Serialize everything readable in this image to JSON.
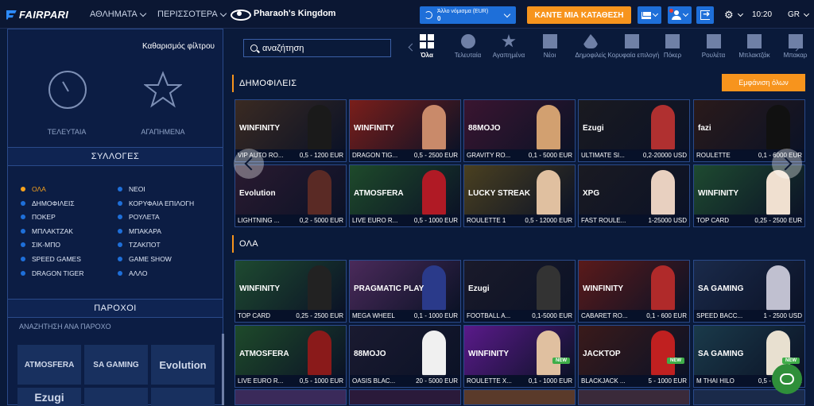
{
  "header": {
    "logo": "FAIRPARI",
    "nav": [
      {
        "label": "ΑΘΛΗΜΑΤΑ"
      },
      {
        "label": "ΠΕΡΙΣΣΟΤΕΡΑ"
      }
    ],
    "game_title": "Pharaoh's Kingdom",
    "currency_label": "Άλλο νόμισμα (EUR)",
    "currency_value": "0",
    "deposit_label": "ΚΑΝΤΕ ΜΙΑ ΚΑΤΑΘΕΣΗ",
    "time": "10:20",
    "lang": "GR"
  },
  "sidebar": {
    "clear_filter": "Καθαρισμός φίλτρου",
    "recent_label": "ΤΕΛΕΥΤΑΙΑ",
    "favorites_label": "ΑΓΑΠΗΜΕΝΑ",
    "collections_title": "ΣΥΛΛΟΓΕΣ",
    "collections_left": [
      "ΟΛΑ",
      "ΔΗΜΟΦΙΛΕΙΣ",
      "ΠΟΚΕΡ",
      "ΜΠΛΑΚΤΖΑΚ",
      "ΣΙΚ-ΜΠΟ",
      "SPEED GAMES",
      "DRAGON TIGER"
    ],
    "collections_right": [
      "ΝΕΟΙ",
      "ΚΟΡΥΦΑΙΑ ΕΠΙΛΟΓΗ",
      "ΡΟΥΛΕΤΑ",
      "ΜΠΑΚΑΡΑ",
      "ΤΖΑΚΠΟΤ",
      "GAME SHOW",
      "ΑΛΛΟ"
    ],
    "providers_title": "ΠΑΡΟΧΟΙ",
    "providers_search": "ΑΝΑΖΗΤΗΣΗ ΑΝΑ ΠΑΡΟΧΟ",
    "providers": [
      "ATMOSFERA",
      "SA GAMING",
      "Evolution",
      "Ezugi"
    ]
  },
  "search": {
    "value": "αναζήτηση"
  },
  "categories": [
    {
      "label": "Όλα",
      "icon": "grid-icon"
    },
    {
      "label": "Τελευταία",
      "icon": "clock-icon"
    },
    {
      "label": "Αγαπημένα",
      "icon": "star-icon"
    },
    {
      "label": "Νέοι",
      "icon": "new-icon"
    },
    {
      "label": "Δημοφιλείς",
      "icon": "flame-icon"
    },
    {
      "label": "Κορυφαία επιλογή",
      "icon": "top-pick-icon"
    },
    {
      "label": "Πόκερ",
      "icon": "poker-icon"
    },
    {
      "label": "Ρουλέτα",
      "icon": "roulette-icon"
    },
    {
      "label": "Μπλακτζάκ",
      "icon": "blackjack-icon"
    },
    {
      "label": "Μπακαρ",
      "icon": "baccarat-icon"
    }
  ],
  "popular": {
    "title": "ΔΗΜΟΦΙΛΕΙΣ",
    "show_all": "Εμφάνιση όλων",
    "games": [
      {
        "name": "VIP AUTO RO...",
        "limits": "0,5 - 1200 EUR",
        "brand": "WINFINITY",
        "bg": "#3a2a22",
        "fig": "#1a1a1a"
      },
      {
        "name": "DRAGON TIG...",
        "limits": "0,5 - 2500 EUR",
        "brand": "WINFINITY",
        "bg": "#7a1e1a",
        "fig": "#c98a6a"
      },
      {
        "name": "GRAVITY RO...",
        "limits": "0,1 - 5000 EUR",
        "brand": "88MOJO",
        "bg": "#3a1530",
        "fig": "#d2a070"
      },
      {
        "name": "ULTIMATE SI...",
        "limits": "0,2-20000 USD",
        "brand": "Ezugi",
        "bg": "#1a1a20",
        "fig": "#b03030"
      },
      {
        "name": "ROULETTE",
        "limits": "0,1 - 6000 EUR",
        "brand": "fazi",
        "bg": "#2a1a1a",
        "fig": "#111111"
      },
      {
        "name": "LIGHTNING ...",
        "limits": "0,2 - 5000 EUR",
        "brand": "Evolution",
        "bg": "#2a1a30",
        "fig": "#5a2a25"
      },
      {
        "name": "LIVE EURO R...",
        "limits": "0,5 - 1000 EUR",
        "brand": "ATMOSFERA",
        "bg": "#1e4a2a",
        "fig": "#b01a25"
      },
      {
        "name": "ROULETTE 1",
        "limits": "0,5 - 12000 EUR",
        "brand": "LUCKY STREAK",
        "bg": "#4a4020",
        "fig": "#e0c0a0"
      },
      {
        "name": "FAST ROULE...",
        "limits": "1-25000 USD",
        "brand": "XPG",
        "bg": "#1a1a22",
        "fig": "#e8d0c0"
      },
      {
        "name": "TOP CARD",
        "limits": "0,25 - 2500 EUR",
        "brand": "WINFINITY",
        "bg": "#1e4a30",
        "fig": "#f0e0d0"
      }
    ]
  },
  "all": {
    "title": "ΟΛΑ",
    "games": [
      {
        "name": "TOP CARD",
        "limits": "0,25 - 2500 EUR",
        "brand": "WINFINITY",
        "bg": "#1e4a30",
        "fig": "#222222",
        "new": false
      },
      {
        "name": "MEGA WHEEL",
        "limits": "0,1 - 1000 EUR",
        "brand": "PRAGMATIC PLAY",
        "bg": "#4a2a5a",
        "fig": "#2a3a8a",
        "new": false
      },
      {
        "name": "FOOTBALL A...",
        "limits": "0,1-5000 EUR",
        "brand": "Ezugi",
        "bg": "#1a1a2a",
        "fig": "#333333",
        "new": false
      },
      {
        "name": "CABARET RO...",
        "limits": "0,1 - 600 EUR",
        "brand": "WINFINITY",
        "bg": "#5a1a1a",
        "fig": "#b02a2a",
        "new": false
      },
      {
        "name": "SPEED BACC...",
        "limits": "1 - 2500 USD",
        "brand": "SA GAMING",
        "bg": "#1a2a4a",
        "fig": "#c0c0d0",
        "new": false
      },
      {
        "name": "LIVE EURO R...",
        "limits": "0,5 - 1000 EUR",
        "brand": "ATMOSFERA",
        "bg": "#1e4a2a",
        "fig": "#8a1a1a",
        "new": false
      },
      {
        "name": "OASIS BLAC...",
        "limits": "20 - 5000 EUR",
        "brand": "88MOJO",
        "bg": "#1a1a30",
        "fig": "#f0f0f0",
        "new": false
      },
      {
        "name": "ROULETTE X...",
        "limits": "0,1 - 1000 EUR",
        "brand": "WINFINITY",
        "bg": "#5a1a8a",
        "fig": "#e0c0a0",
        "new": true
      },
      {
        "name": "BLACKJACK ...",
        "limits": "5 - 1000 EUR",
        "brand": "JACKTOP",
        "bg": "#3a1a1a",
        "fig": "#c02020",
        "new": true
      },
      {
        "name": "M THAI HILO",
        "limits": "0,5 - 5000 EUR",
        "brand": "SA GAMING",
        "bg": "#1a3a4a",
        "fig": "#e8e0d0",
        "new": true
      }
    ]
  },
  "new_badge": "NEW"
}
